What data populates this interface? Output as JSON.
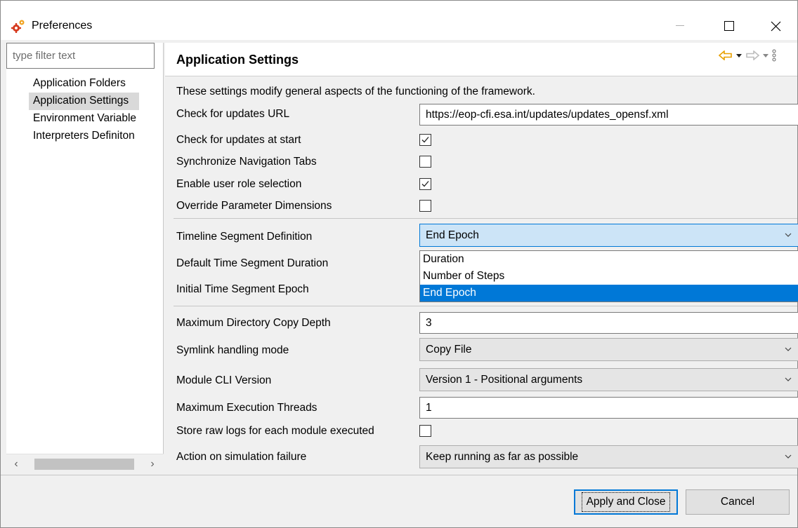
{
  "window": {
    "title": "Preferences",
    "minimize_icon": "minimize-icon",
    "maximize_icon": "maximize-icon",
    "close_icon": "close-icon"
  },
  "sidebar": {
    "filter_placeholder": "type filter text",
    "items": [
      {
        "label": "Application Folders",
        "selected": false
      },
      {
        "label": "Application Settings",
        "selected": true
      },
      {
        "label": "Environment Variable",
        "selected": false
      },
      {
        "label": "Interpreters Definiton",
        "selected": false
      }
    ]
  },
  "page": {
    "title": "Application Settings",
    "description": "These settings modify general aspects of the functioning of the framework.",
    "fields": {
      "updates_url_label": "Check for updates URL",
      "updates_url_value": "https://eop-cfi.esa.int/updates/updates_opensf.xml",
      "check_updates_label": "Check for updates at start",
      "check_updates_checked": true,
      "sync_tabs_label": "Synchronize Navigation Tabs",
      "sync_tabs_checked": false,
      "user_role_label": "Enable user role selection",
      "user_role_checked": true,
      "override_dims_label": "Override Parameter Dimensions",
      "override_dims_checked": false,
      "timeline_label": "Timeline Segment Definition",
      "timeline_value": "End Epoch",
      "timeline_options": [
        "Duration",
        "Number of Steps",
        "End Epoch"
      ],
      "default_duration_label": "Default Time Segment Duration",
      "initial_epoch_label": "Initial Time Segment Epoch",
      "max_copy_depth_label": "Maximum Directory Copy Depth",
      "max_copy_depth_value": "3",
      "symlink_label": "Symlink handling mode",
      "symlink_value": "Copy File",
      "cli_version_label": "Module CLI Version",
      "cli_version_value": "Version 1 - Positional arguments",
      "max_threads_label": "Maximum Execution Threads",
      "max_threads_value": "1",
      "raw_logs_label": "Store raw logs for each module executed",
      "raw_logs_checked": false,
      "sim_failure_label": "Action on simulation failure",
      "sim_failure_value": "Keep running as far as possible"
    }
  },
  "buttons": {
    "apply_close": "Apply and Close",
    "cancel": "Cancel"
  },
  "colors": {
    "accent": "#0078d7",
    "selection_bg": "#d9d9d9",
    "dropdown_open_bg": "#cce4f7",
    "nav_arrow": "#e8a000"
  }
}
